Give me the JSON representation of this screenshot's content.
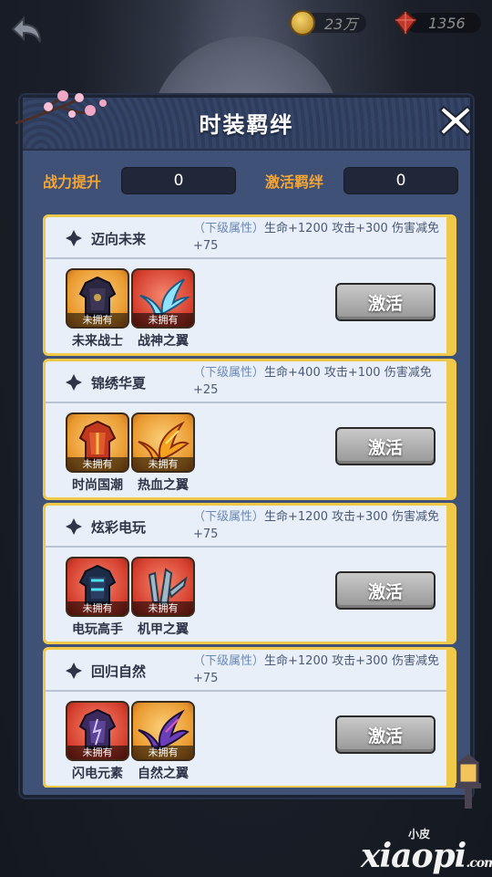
{
  "topbar": {
    "coin_amount": "23万",
    "gem_amount": "1356"
  },
  "panel": {
    "title": "时装羁绊",
    "power_label": "战力提升",
    "power_value": "0",
    "activate_label": "激活羁绊",
    "activate_value": "0"
  },
  "sets": [
    {
      "name": "迈向未来",
      "attr_prefix": "（下级属性）",
      "attr_text": "生命+1200 攻击+300 伤害减免+75",
      "items": [
        {
          "name": "未来战士",
          "tag": "未拥有",
          "icon": "armor-icon",
          "bg": "orange"
        },
        {
          "name": "战神之翼",
          "tag": "未拥有",
          "icon": "wing-icon",
          "bg": "red"
        }
      ],
      "button": "激活"
    },
    {
      "name": "锦绣华夏",
      "attr_prefix": "（下级属性）",
      "attr_text": "生命+400 攻击+100 伤害减免+25",
      "items": [
        {
          "name": "时尚国潮",
          "tag": "未拥有",
          "icon": "armor-icon",
          "bg": "orange"
        },
        {
          "name": "热血之翼",
          "tag": "未拥有",
          "icon": "wing-icon",
          "bg": "orange"
        }
      ],
      "button": "激活"
    },
    {
      "name": "炫彩电玩",
      "attr_prefix": "（下级属性）",
      "attr_text": "生命+1200 攻击+300 伤害减免+75",
      "items": [
        {
          "name": "电玩高手",
          "tag": "未拥有",
          "icon": "armor-icon",
          "bg": "red"
        },
        {
          "name": "机甲之翼",
          "tag": "未拥有",
          "icon": "wing-icon",
          "bg": "red"
        }
      ],
      "button": "激活"
    },
    {
      "name": "回归自然",
      "attr_prefix": "（下级属性）",
      "attr_text": "生命+1200 攻击+300 伤害减免+75",
      "items": [
        {
          "name": "闪电元素",
          "tag": "未拥有",
          "icon": "armor-icon",
          "bg": "red"
        },
        {
          "name": "自然之翼",
          "tag": "未拥有",
          "icon": "wing-icon",
          "bg": "orange"
        }
      ],
      "button": "激活"
    }
  ],
  "watermark": {
    "small": "小皮",
    "big": "xiaopi",
    "suffix": ".com"
  }
}
